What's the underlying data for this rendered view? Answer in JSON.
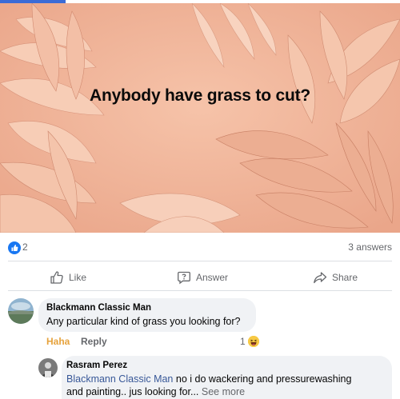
{
  "post": {
    "text": "Anybody have grass to cut?"
  },
  "stats": {
    "reactions_count": "2",
    "answers_count": "3 answers"
  },
  "actions": {
    "like_label": "Like",
    "answer_label": "Answer",
    "share_label": "Share"
  },
  "comment1": {
    "author": "Blackmann Classic Man",
    "text": "Any particular kind of grass you looking for?",
    "reaction_label": "Haha",
    "reply_label": "Reply",
    "reaction_count": "1"
  },
  "comment2": {
    "author": "Rasram Perez",
    "mention": "Blackmann Classic Man",
    "text_line1": " no i do wackering and pressurewashing",
    "text_line2": "and painting.. jus looking for...",
    "see_more": " See more"
  },
  "colors": {
    "background_peach": "#f0b49a",
    "facebook_blue": "#1877f2",
    "haha_orange": "#e6a23c"
  },
  "icons": [
    "like-thumb-icon",
    "answer-bubble-icon",
    "share-arrow-icon",
    "like-reaction-icon",
    "haha-emoji-icon"
  ]
}
